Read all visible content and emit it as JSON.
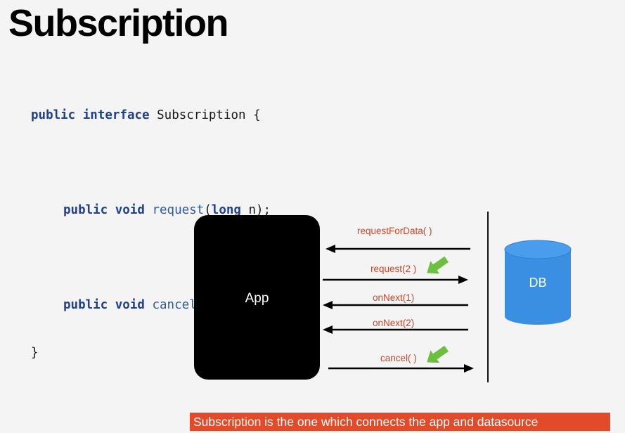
{
  "title": "Subscription",
  "code": {
    "line1": {
      "kw1": "public",
      "kw2": "interface",
      "rest": " Subscription {"
    },
    "line2": {
      "kw1": "public",
      "kw2": "void",
      "fn": "request",
      "p1": "(",
      "kw3": "long",
      "rest": " n);"
    },
    "line3": {
      "kw1": "public",
      "kw2": "void",
      "fn": "cancel",
      "rest": "();"
    },
    "line4": "}"
  },
  "diagram": {
    "app_label": "App",
    "db_label": "DB",
    "messages": [
      {
        "label": "requestForData( )",
        "direction": "to-app"
      },
      {
        "label": "request(2 )",
        "direction": "to-db",
        "highlight": "green-arrow-icon"
      },
      {
        "label": "onNext(1)",
        "direction": "to-app"
      },
      {
        "label": "onNext(2)",
        "direction": "to-app"
      },
      {
        "label": "cancel( )",
        "direction": "to-db",
        "highlight": "green-arrow-icon"
      }
    ],
    "colors": {
      "app": "#000000",
      "db": "#3b8fe3",
      "message_text": "#c9472b",
      "highlight_arrow": "#6cbf3f"
    }
  },
  "banner": {
    "text": "Subscription is the one which connects the app and datasource",
    "color": "#e34a2a"
  }
}
